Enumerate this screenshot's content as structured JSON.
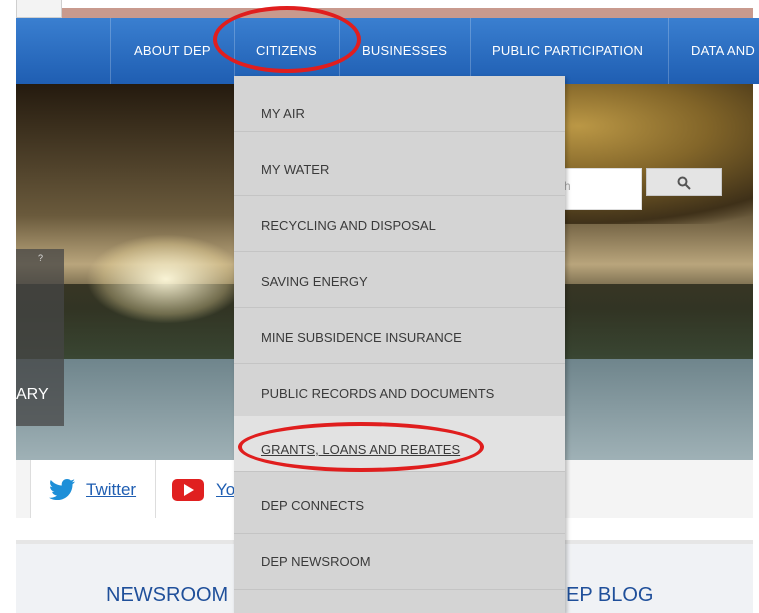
{
  "nav": {
    "items": [
      {
        "label": "ABOUT DEP"
      },
      {
        "label": "CITIZENS"
      },
      {
        "label": "BUSINESSES"
      },
      {
        "label": "PUBLIC PARTICIPATION"
      },
      {
        "label": "DATA AND"
      }
    ]
  },
  "dropdown": {
    "items": [
      {
        "label": "MY AIR"
      },
      {
        "label": "MY WATER"
      },
      {
        "label": "RECYCLING AND DISPOSAL"
      },
      {
        "label": "SAVING ENERGY"
      },
      {
        "label": "MINE SUBSIDENCE INSURANCE"
      },
      {
        "label": "PUBLIC RECORDS AND DOCUMENTS"
      },
      {
        "label": "GRANTS, LOANS AND REBATES"
      },
      {
        "label": "DEP CONNECTS"
      },
      {
        "label": "DEP NEWSROOM"
      }
    ]
  },
  "hero": {
    "left_label": "ARY",
    "search_placeholder_fragment": "h"
  },
  "social": {
    "twitter": "Twitter",
    "youtube": "Yo"
  },
  "sections": {
    "newsroom": "NEWSROOM",
    "blog": "EP BLOG"
  },
  "colors": {
    "nav": "#1f5eb2",
    "annotation": "#e01e1e",
    "link": "#1f5eb2"
  }
}
